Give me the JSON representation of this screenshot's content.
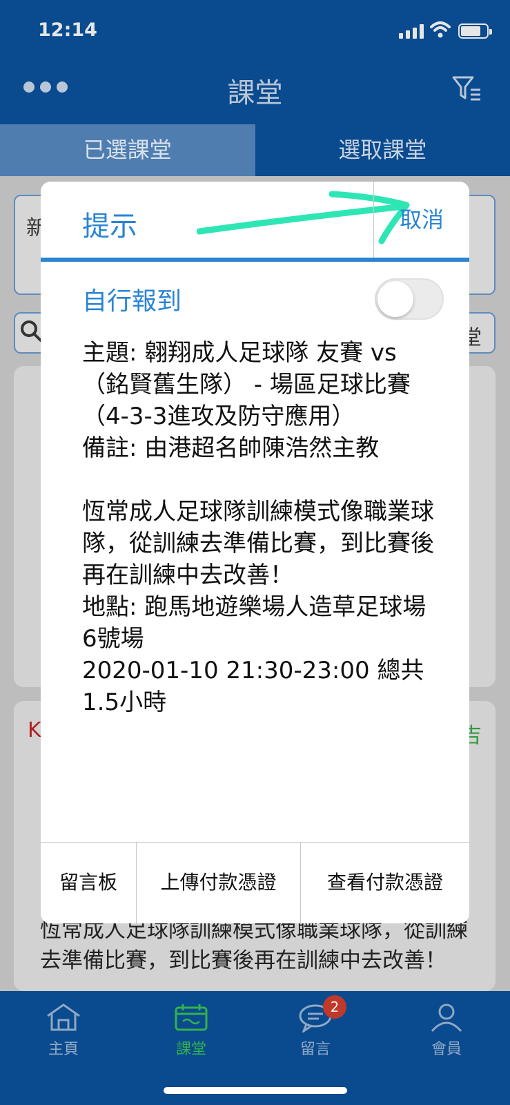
{
  "status_bar": {
    "time": "12:14"
  },
  "nav": {
    "title": "課堂"
  },
  "segments": [
    {
      "label": "已選課堂",
      "active": true
    },
    {
      "label": "選取課堂",
      "active": false
    }
  ],
  "background": {
    "frag_left": "新",
    "frag_right": "堂",
    "frag_card_left": "K",
    "frag_card_right": "吉",
    "bg_text": "恆常成人足球隊訓練模式像職業球隊，從訓練去準備比賽，到比賽後再在訓練中去改善！"
  },
  "modal": {
    "title": "提示",
    "cancel_label": "取消",
    "toggle_label": "自行報到",
    "toggle_on": false,
    "body": {
      "topic": "主題: 翱翔成人足球隊 友賽 vs （銘賢舊生隊） - 場區足球比賽（4-3-3進攻及防守應用）",
      "remark": "備註: 由港超名帥陳浩然主教",
      "description": "恆常成人足球隊訓練模式像職業球隊，從訓練去準備比賽，到比賽後再在訓練中去改善！",
      "location": "地點: 跑馬地遊樂場人造草足球場6號場",
      "datetime": "2020-01-10 21:30-23:00 總共1.5小時"
    },
    "footer": {
      "board_label": "留言板",
      "upload_label": "上傳付款憑證",
      "view_label": "查看付款憑證"
    }
  },
  "tabbar": {
    "items": [
      {
        "label": "主頁",
        "icon": "home-icon"
      },
      {
        "label": "課堂",
        "icon": "calendar-icon",
        "active": true
      },
      {
        "label": "留言",
        "icon": "chat-icon",
        "badge": "2"
      },
      {
        "label": "會員",
        "icon": "person-icon"
      }
    ]
  },
  "colors": {
    "brand_blue": "#0a4a8f",
    "accent": "#2a84d2",
    "active_green": "#33b24a",
    "annotation_arrow": "#2ee6b4"
  }
}
